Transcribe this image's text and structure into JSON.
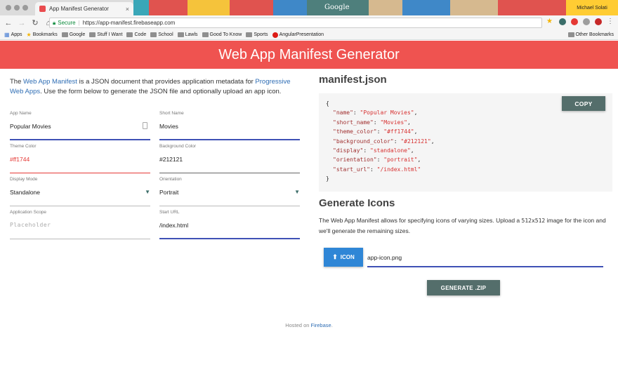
{
  "browser": {
    "tab_title": "App Manifest Generator",
    "tab_close": "×",
    "google_logo": "Google",
    "profile_name": "Michael Solati",
    "secure_label": "Secure",
    "url": "https://app-manifest.firebaseapp.com",
    "bookmarks": [
      "Apps",
      "Bookmarks",
      "Google",
      "Stuff I Want",
      "Code",
      "School",
      "Lawls",
      "Good To Know",
      "Sports",
      "AngularPresentation"
    ],
    "other_bookmarks": "Other Bookmarks"
  },
  "header": {
    "title": "Web App Manifest Generator"
  },
  "intro": {
    "pre": "The ",
    "link1": "Web App Manifest",
    "mid": " is a JSON document that provides application metadata for ",
    "link2": "Progressive Web Apps",
    "post": ". Use the form below to generate the JSON file and optionally upload an app icon."
  },
  "form": {
    "app_name": {
      "label": "App Name",
      "value": "Popular Movies"
    },
    "short_name": {
      "label": "Short Name",
      "value": "Movies"
    },
    "theme_color": {
      "label": "Theme Color",
      "value": "#ff1744"
    },
    "background_color": {
      "label": "Background Color",
      "value": "#212121"
    },
    "display_mode": {
      "label": "Display Mode",
      "value": "Standalone"
    },
    "orientation": {
      "label": "Orientation",
      "value": "Portrait"
    },
    "scope": {
      "label": "Application Scope",
      "placeholder": "Placeholder"
    },
    "start_url": {
      "label": "Start URL",
      "value": "/index.html"
    }
  },
  "manifest": {
    "title": "manifest.json",
    "copy_label": "COPY",
    "open_brace": "{",
    "close_brace": "}",
    "entries": [
      {
        "key": "\"name\"",
        "value": "\"Popular Movies\""
      },
      {
        "key": "\"short_name\"",
        "value": "\"Movies\""
      },
      {
        "key": "\"theme_color\"",
        "value": "\"#ff1744\""
      },
      {
        "key": "\"background_color\"",
        "value": "\"#212121\""
      },
      {
        "key": "\"display\"",
        "value": "\"standalone\""
      },
      {
        "key": "\"orientation\"",
        "value": "\"portrait\""
      },
      {
        "key": "\"start_url\"",
        "value": "\"/index.html\""
      }
    ]
  },
  "icons": {
    "title": "Generate Icons",
    "desc_pre": "The Web App Manifest allows for specifying icons of varying sizes. Upload a ",
    "desc_size": "512x512",
    "desc_post": " image for the icon and we'll generate the remaining sizes.",
    "icon_button": "ICON",
    "file_name": "app-icon.png",
    "zip_button": "GENERATE .ZIP"
  },
  "footer": {
    "pre": "Hosted on ",
    "link": "Firebase",
    "post": "."
  },
  "colors": {
    "header": "#ef5350",
    "primary_button": "#546e6b",
    "upload_button": "#2f86d6",
    "focus_underline": "#3f51b5",
    "error": "#e53935"
  }
}
